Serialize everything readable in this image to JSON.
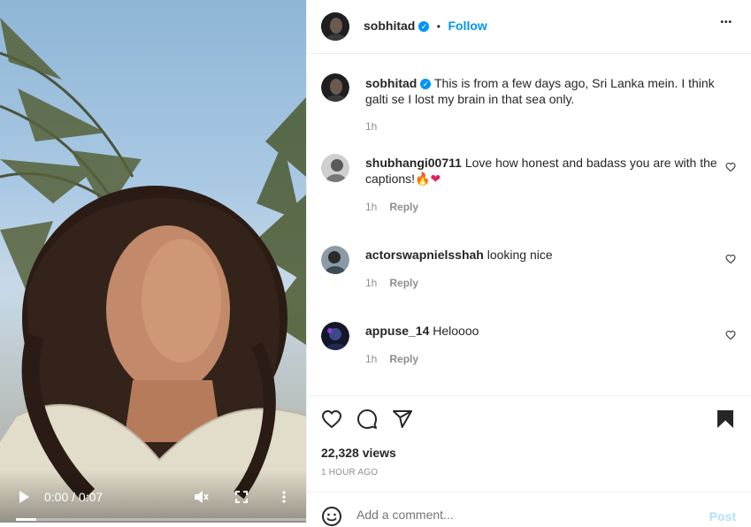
{
  "video": {
    "time": "0:00 / 0:07",
    "progress": 0.07
  },
  "header": {
    "username": "sobhitad",
    "dot": "•",
    "follow": "Follow",
    "more": "•••"
  },
  "caption": {
    "username": "sobhitad",
    "text": "This is from a few days ago, Sri Lanka mein. I think galti se I lost my brain in that sea only.",
    "time": "1h"
  },
  "comments": [
    {
      "username": "shubhangi00711",
      "text": "Love how honest and badass you are with the captions!",
      "emoji": "🔥❤",
      "time": "1h",
      "reply": "Reply"
    },
    {
      "username": "actorswapnielsshah",
      "text": "looking nice",
      "time": "1h",
      "reply": "Reply"
    },
    {
      "username": "appuse_14",
      "text": "Heloooo",
      "time": "1h",
      "reply": "Reply"
    }
  ],
  "stats": {
    "views": "22,328 views",
    "ago": "1 HOUR AGO"
  },
  "add_comment": {
    "placeholder": "Add a comment...",
    "post": "Post"
  },
  "colors": {
    "accent": "#0095f6",
    "text": "#262626",
    "muted": "#8e8e8e"
  }
}
